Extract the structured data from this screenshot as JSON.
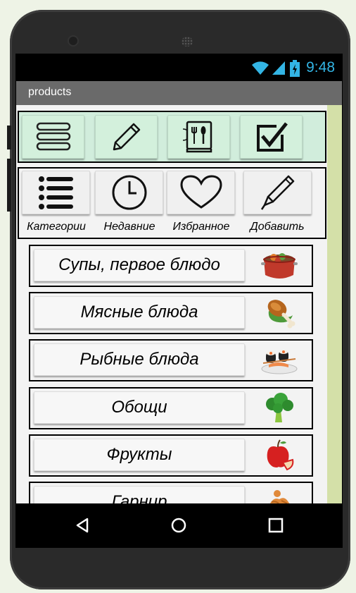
{
  "status_bar": {
    "time": "9:48",
    "icons": [
      "wifi-icon",
      "signal-icon",
      "battery-icon"
    ],
    "accent_color": "#33b5e5"
  },
  "app_bar": {
    "title": "products"
  },
  "toolbar": {
    "icons": [
      "menu-icon",
      "pencil-icon",
      "recipe-book-icon",
      "checkbox-icon"
    ]
  },
  "nav": {
    "items": [
      {
        "label": "Категории",
        "icon": "list-icon"
      },
      {
        "label": "Недавние",
        "icon": "clock-icon"
      },
      {
        "label": "Избранное",
        "icon": "heart-icon"
      },
      {
        "label": "Добавить",
        "icon": "pen-icon"
      }
    ]
  },
  "categories": [
    {
      "label": "Супы, первое блюдо",
      "icon": "soup-pot-icon"
    },
    {
      "label": "Мясные блюда",
      "icon": "chicken-leg-icon"
    },
    {
      "label": "Рыбные блюда",
      "icon": "sushi-icon"
    },
    {
      "label": "Обощи",
      "icon": "broccoli-icon"
    },
    {
      "label": "Фрукты",
      "icon": "apple-icon"
    },
    {
      "label": "Гарнир",
      "icon": "pasta-icon"
    }
  ],
  "system_nav": {
    "icons": [
      "back-icon",
      "home-icon",
      "recents-icon"
    ]
  }
}
